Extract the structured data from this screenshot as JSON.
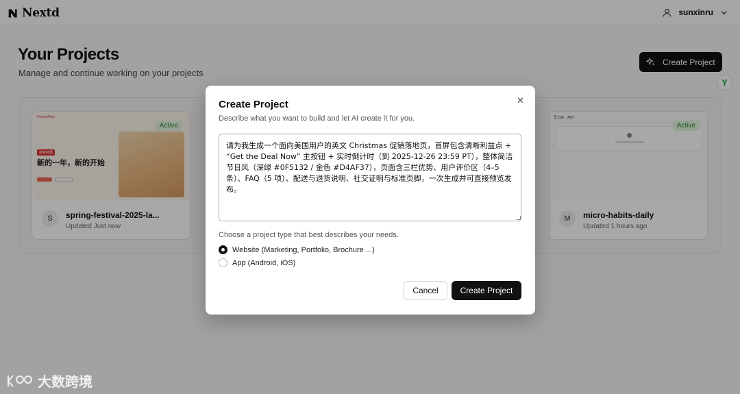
{
  "app": {
    "name": "Nextd"
  },
  "user": {
    "name": "sunxinru"
  },
  "page": {
    "title": "Your Projects",
    "subtitle": "Manage and continue working on your projects",
    "create_button": "Create Project"
  },
  "projects": [
    {
      "initial": "S",
      "name": "spring-festival-2025-la...",
      "updated": "Updated Just now",
      "status": "Active",
      "thumb_brand": "FestivalApp",
      "thumb_tag": "新春特惠",
      "thumb_heading": "新的一年，新的开始"
    },
    {
      "initial": "M",
      "name": "micro-habits-daily",
      "updated": "Updated 1 hours ago",
      "status": "Active",
      "thumb_heading": "早上好，用户"
    }
  ],
  "modal": {
    "title": "Create Project",
    "description": "Describe what you want to build and let AI create it for you.",
    "prompt": "请为我生成一个面向美国用户的英文 Christmas 促销落地页，首屏包含清晰利益点 + “Get the Deal Now” 主按钮 + 实时倒计时（到 2025-12-26 23:59 PT），整体简洁节日风（深绿 #0F5132 / 金色 #D4AF37），页面含三栏优势、用户评价区（4–5 条）、FAQ（5 项）、配送与退货说明、社交证明与标准页脚，一次生成并可直接预览发布。",
    "type_label": "Choose a project type that best describes your needs.",
    "options": [
      {
        "label": "Website (Marketing, Portfolio, Brochure ...)",
        "selected": true
      },
      {
        "label": "App (Android, iOS)",
        "selected": false
      }
    ],
    "cancel": "Cancel",
    "submit": "Create Project"
  },
  "helper": {
    "glyph": "Y"
  },
  "watermark": {
    "text": "大数跨境"
  },
  "colors": {
    "primary": "#111111",
    "active_badge_bg": "#e3f5e0",
    "active_badge_text": "#2e8a3a"
  }
}
